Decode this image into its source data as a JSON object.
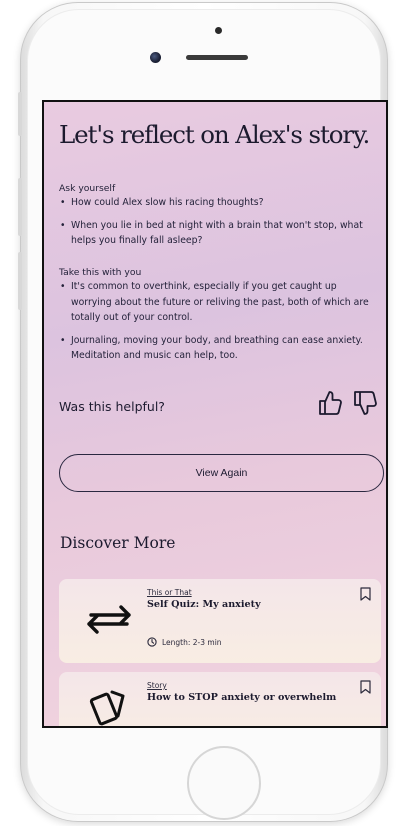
{
  "screen": {
    "title": "Let's reflect on Alex's story.",
    "ask_label": "Ask yourself",
    "ask_items": [
      "How could Alex slow his racing thoughts?",
      "When you lie in bed at night with a brain that won't stop, what helps you finally fall asleep?"
    ],
    "take_label": "Take this with you",
    "take_items": [
      "It's common to overthink, especially if you get caught up worrying about the future or reliving the past, both of which are totally out of your control.",
      "Journaling, moving your body, and breathing can ease anxiety. Meditation and music can help, too."
    ],
    "helpful_question": "Was this helpful?",
    "view_again_label": "View Again",
    "discover_title": "Discover More",
    "cards": [
      {
        "kicker": "This or That",
        "title": "Self Quiz: My anxiety",
        "meta": "Length: 2-3 min",
        "icon": "swap-arrows-icon"
      },
      {
        "kicker": "Story",
        "title": "How to STOP anxiety or overwhelm",
        "icon": "cards-icon"
      }
    ]
  },
  "colors": {
    "text": "#1c1a2e",
    "gradient_top": "#e9cbe0",
    "gradient_bottom": "#f1d4df",
    "card_bg": "#f6eae6"
  }
}
